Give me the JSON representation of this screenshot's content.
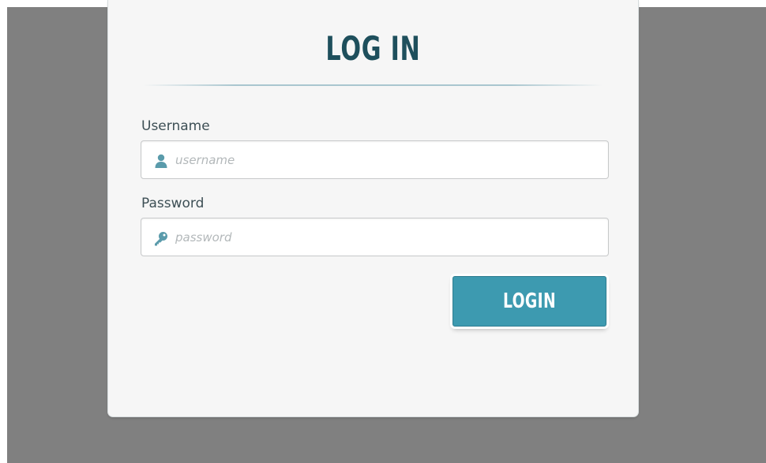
{
  "login_card": {
    "title": "Log In",
    "username": {
      "label": "Username",
      "placeholder": "username",
      "value": "",
      "icon": "user-icon"
    },
    "password": {
      "label": "Password",
      "placeholder": "password",
      "value": "",
      "icon": "key-icon"
    },
    "login_button_label": "LOGIN"
  },
  "colors": {
    "backdrop": "#808080",
    "card_background": "#f6f6f6",
    "title": "#1e4f5c",
    "accent": "#3d9ab0",
    "icon": "#5a9bab"
  }
}
